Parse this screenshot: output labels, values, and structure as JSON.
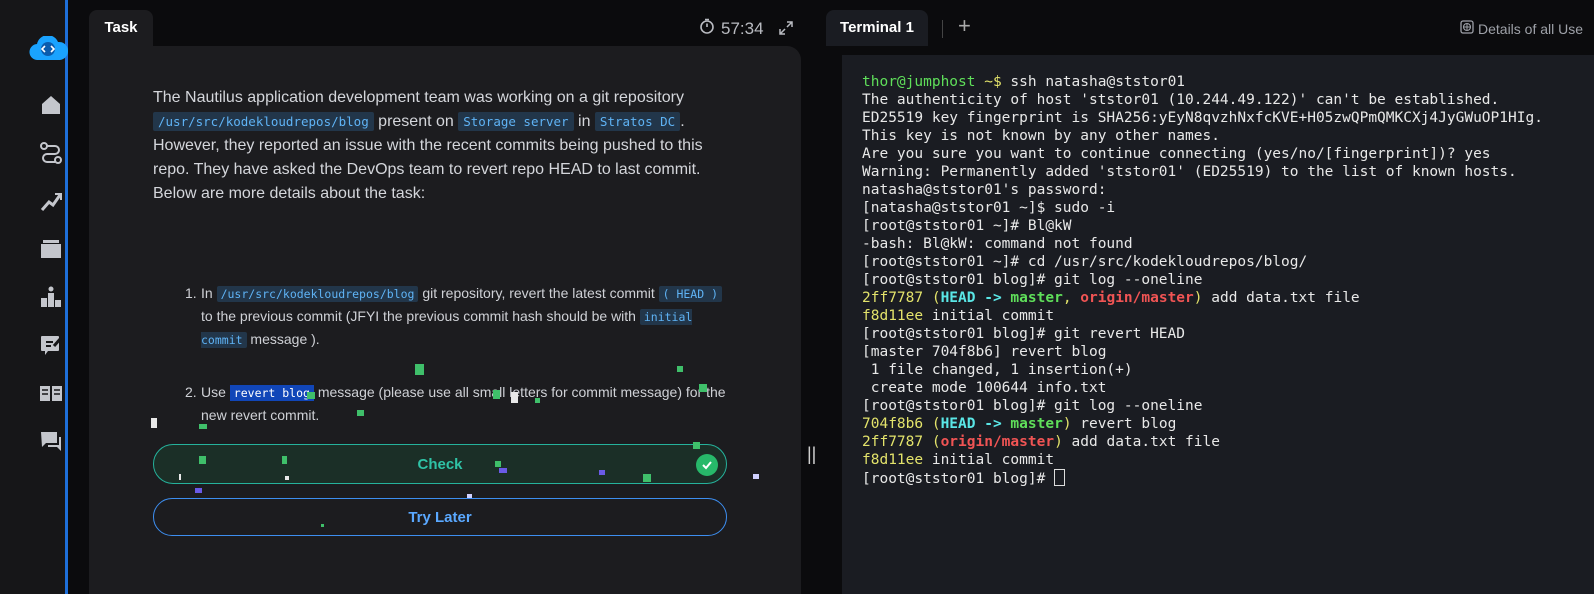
{
  "task": {
    "tab_label": "Task",
    "timer": "57:34",
    "description": {
      "p1": "The Nautilus application development team was working on a git repository ",
      "repo_path": "/usr/src/kodekloudrepos/blog",
      "p2": " present on ",
      "server": "Storage server",
      "p3": " in ",
      "dc": "Stratos DC",
      "p4": ". However, they reported an issue with the recent commits being pushed to this repo. They have asked the DevOps team to revert repo HEAD to last commit. Below are more details about the task:"
    },
    "steps": [
      {
        "num": "1.",
        "t1": "In ",
        "c1": "/usr/src/kodekloudrepos/blog",
        "t2": " git repository, revert the latest commit ",
        "c2": "( HEAD )",
        "t3": " to the previous commit (JFYI the previous commit hash should be with ",
        "c3": "initial commit",
        "t4": " message )."
      },
      {
        "num": "2.",
        "t1": "Use ",
        "c1": "revert blog",
        "t2": " message (please use all small letters for commit message) for the new revert commit."
      }
    ],
    "check_label": "Check",
    "try_later_label": "Try Later"
  },
  "terminal": {
    "tab_label": "Terminal 1",
    "add_label": "+",
    "details_label": "Details of all Use",
    "lines": [
      [
        {
          "t": "thor@jumphost",
          "c": "g"
        },
        {
          "t": " ~$",
          "c": "y"
        },
        {
          "t": " ssh natasha@ststor01",
          "c": ""
        }
      ],
      [
        {
          "t": "The authenticity of host 'ststor01 (10.244.49.122)' can't be established.",
          "c": ""
        }
      ],
      [
        {
          "t": "ED25519 key fingerprint is SHA256:yEyN8qvzhNxfcKVE+H05zwQPmQMKCXj4JyGWuOP1HIg.",
          "c": ""
        }
      ],
      [
        {
          "t": "This key is not known by any other names.",
          "c": ""
        }
      ],
      [
        {
          "t": "Are you sure you want to continue connecting (yes/no/[fingerprint])? yes",
          "c": ""
        }
      ],
      [
        {
          "t": "Warning: Permanently added 'ststor01' (ED25519) to the list of known hosts.",
          "c": ""
        }
      ],
      [
        {
          "t": "natasha@ststor01's password:",
          "c": ""
        }
      ],
      [
        {
          "t": "[natasha@ststor01 ~]$ sudo -i",
          "c": ""
        }
      ],
      [
        {
          "t": "[root@ststor01 ~]# Bl@kW",
          "c": ""
        }
      ],
      [
        {
          "t": "-bash: Bl@kW: command not found",
          "c": ""
        }
      ],
      [
        {
          "t": "[root@ststor01 ~]# cd /usr/src/kodekloudrepos/blog/",
          "c": ""
        }
      ],
      [
        {
          "t": "[root@ststor01 blog]# git log --oneline",
          "c": ""
        }
      ],
      [
        {
          "t": "2ff7787",
          "c": "y"
        },
        {
          "t": " (",
          "c": "y"
        },
        {
          "t": "HEAD -> ",
          "c": "c"
        },
        {
          "t": "master",
          "c": "gb"
        },
        {
          "t": ", ",
          "c": "y"
        },
        {
          "t": "origin/master",
          "c": "r"
        },
        {
          "t": ")",
          "c": "y"
        },
        {
          "t": " add data.txt file",
          "c": ""
        }
      ],
      [
        {
          "t": "f8d11ee",
          "c": "y"
        },
        {
          "t": " initial commit",
          "c": ""
        }
      ],
      [
        {
          "t": "[root@ststor01 blog]# git revert HEAD",
          "c": ""
        }
      ],
      [
        {
          "t": "[master 704f8b6] revert blog",
          "c": ""
        }
      ],
      [
        {
          "t": " 1 file changed, 1 insertion(+)",
          "c": ""
        }
      ],
      [
        {
          "t": " create mode 100644 info.txt",
          "c": ""
        }
      ],
      [
        {
          "t": "[root@ststor01 blog]# git log --oneline",
          "c": ""
        }
      ],
      [
        {
          "t": "704f8b6",
          "c": "y"
        },
        {
          "t": " (",
          "c": "y"
        },
        {
          "t": "HEAD -> ",
          "c": "c"
        },
        {
          "t": "master",
          "c": "gb"
        },
        {
          "t": ")",
          "c": "y"
        },
        {
          "t": " revert blog",
          "c": ""
        }
      ],
      [
        {
          "t": "2ff7787",
          "c": "y"
        },
        {
          "t": " (",
          "c": "y"
        },
        {
          "t": "origin/master",
          "c": "r"
        },
        {
          "t": ")",
          "c": "y"
        },
        {
          "t": " add data.txt file",
          "c": ""
        }
      ],
      [
        {
          "t": "f8d11ee",
          "c": "y"
        },
        {
          "t": " initial commit",
          "c": ""
        }
      ],
      [
        {
          "t": "[root@ststor01 blog]# ",
          "c": ""
        }
      ]
    ]
  },
  "colors": {
    "accent": "#1e6fd9",
    "check": "#2fc3a6",
    "try_later": "#5aa8ff"
  },
  "icons": [
    "cloud-logo-icon",
    "home-icon",
    "route-icon",
    "chart-icon",
    "tickets-icon",
    "leaderboard-icon",
    "edit-icon",
    "book-icon",
    "chat-icon",
    "timer-icon",
    "expand-icon",
    "check-circle-icon",
    "globe-icon"
  ]
}
